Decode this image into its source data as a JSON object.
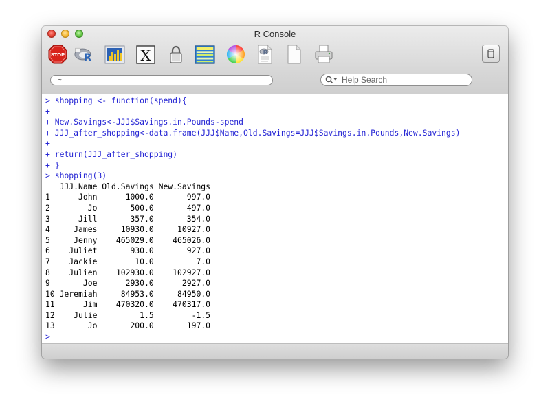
{
  "window": {
    "title": "R Console"
  },
  "toolbar": {
    "tools": [
      {
        "icon": "stop-icon",
        "label": "STOP"
      },
      {
        "icon": "r-logo-icon"
      },
      {
        "icon": "bar-chart-icon"
      },
      {
        "icon": "x11-icon",
        "label": "X"
      },
      {
        "icon": "lock-icon"
      },
      {
        "icon": "data-table-icon"
      },
      {
        "icon": "color-wheel-icon"
      },
      {
        "icon": "r-document-icon"
      },
      {
        "icon": "blank-document-icon"
      },
      {
        "icon": "print-icon"
      },
      {
        "icon": "sidebar-toggle-icon"
      }
    ]
  },
  "path_field": {
    "value": "~"
  },
  "search": {
    "placeholder": "Help Search"
  },
  "colors": {
    "input": "#2525d4",
    "output": "#000000"
  },
  "console": {
    "lines": [
      {
        "type": "input",
        "text": "> shopping <- function(spend){"
      },
      {
        "type": "input",
        "text": "+"
      },
      {
        "type": "input",
        "text": "+ New.Savings<-JJJ$Savings.in.Pounds-spend"
      },
      {
        "type": "input",
        "text": "+ JJJ_after_shopping<-data.frame(JJJ$Name,Old.Savings=JJJ$Savings.in.Pounds,New.Savings)"
      },
      {
        "type": "input",
        "text": "+"
      },
      {
        "type": "input",
        "text": "+ return(JJJ_after_shopping)"
      },
      {
        "type": "input",
        "text": "+ }"
      },
      {
        "type": "input",
        "text": "> shopping(3)"
      },
      {
        "type": "output",
        "text": "   JJJ.Name Old.Savings New.Savings"
      },
      {
        "type": "output",
        "text": "1      John      1000.0       997.0"
      },
      {
        "type": "output",
        "text": "2        Jo       500.0       497.0"
      },
      {
        "type": "output",
        "text": "3      Jill       357.0       354.0"
      },
      {
        "type": "output",
        "text": "4     James     10930.0     10927.0"
      },
      {
        "type": "output",
        "text": "5     Jenny    465029.0    465026.0"
      },
      {
        "type": "output",
        "text": "6    Juliet       930.0       927.0"
      },
      {
        "type": "output",
        "text": "7    Jackie        10.0         7.0"
      },
      {
        "type": "output",
        "text": "8    Julien    102930.0    102927.0"
      },
      {
        "type": "output",
        "text": "9       Joe      2930.0      2927.0"
      },
      {
        "type": "output",
        "text": "10 Jeremiah     84953.0     84950.0"
      },
      {
        "type": "output",
        "text": "11      Jim    470320.0    470317.0"
      },
      {
        "type": "output",
        "text": "12    Julie         1.5        -1.5"
      },
      {
        "type": "output",
        "text": "13       Jo       200.0       197.0"
      },
      {
        "type": "input",
        "text": ">"
      }
    ]
  }
}
